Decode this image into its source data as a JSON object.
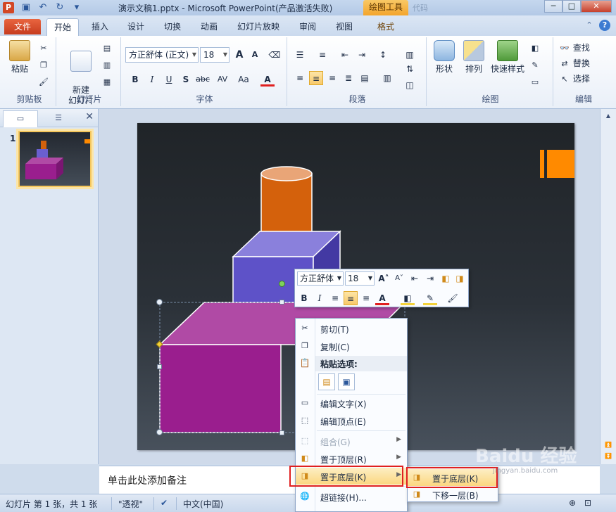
{
  "titlebar": {
    "app_icon": "P",
    "title": "演示文稿1.pptx - Microsoft PowerPoint(产品激活失败)",
    "context_tools": "绘图工具",
    "ghost_label": "代码",
    "minimize": "─",
    "maximize": "□",
    "close": "✕"
  },
  "tabs": {
    "file": "文件",
    "items": [
      "开始",
      "插入",
      "设计",
      "切换",
      "动画",
      "幻灯片放映",
      "审阅",
      "视图",
      "格式"
    ]
  },
  "ribbon": {
    "clipboard": {
      "label": "剪贴板",
      "paste": "粘贴"
    },
    "slides": {
      "label": "幻灯片",
      "new_slide": "新建\n幻灯片"
    },
    "font": {
      "label": "字体",
      "font_name": "方正舒体 (正文)",
      "font_size": "18",
      "bold": "B",
      "italic": "I",
      "underline": "U",
      "shadow": "S",
      "strike": "abc",
      "spacing": "AV",
      "case": "Aa",
      "color": "A",
      "grow": "A",
      "shrink": "A"
    },
    "paragraph": {
      "label": "段落"
    },
    "drawing": {
      "label": "绘图",
      "shapes": "形状",
      "arrange": "排列",
      "quick_styles": "快速样式"
    },
    "editing": {
      "label": "编辑",
      "find": "查找",
      "replace": "替换",
      "select": "选择"
    }
  },
  "leftpanel": {
    "slide_number": "1"
  },
  "notes": {
    "placeholder": "单击此处添加备注"
  },
  "statusbar": {
    "slide_info": "幻灯片 第 1 张，共 1 张",
    "theme": "\"透视\"",
    "language": "中文(中国)"
  },
  "minibar": {
    "font_name": "方正舒体",
    "font_size": "18",
    "bold": "B",
    "italic": "I"
  },
  "context_menu": {
    "cut": "剪切(T)",
    "copy": "复制(C)",
    "paste_options": "粘贴选项:",
    "edit_text": "编辑文字(X)",
    "edit_points": "编辑顶点(E)",
    "group": "组合(G)",
    "bring_to_front": "置于顶层(R)",
    "send_to_back": "置于底层(K)",
    "hyperlink": "超链接(H)..."
  },
  "submenu": {
    "send_to_back": "置于底层(K)",
    "send_backward": "下移一层(B)"
  },
  "watermark": {
    "text": "Baidu 经验",
    "sub": "jingyan.baidu.com"
  },
  "colors": {
    "accent_orange": "#ff8a00",
    "cylinder": "#d4610c",
    "cube_top": "#6a5fd0",
    "cube_bottom": "#9a1e8e"
  }
}
